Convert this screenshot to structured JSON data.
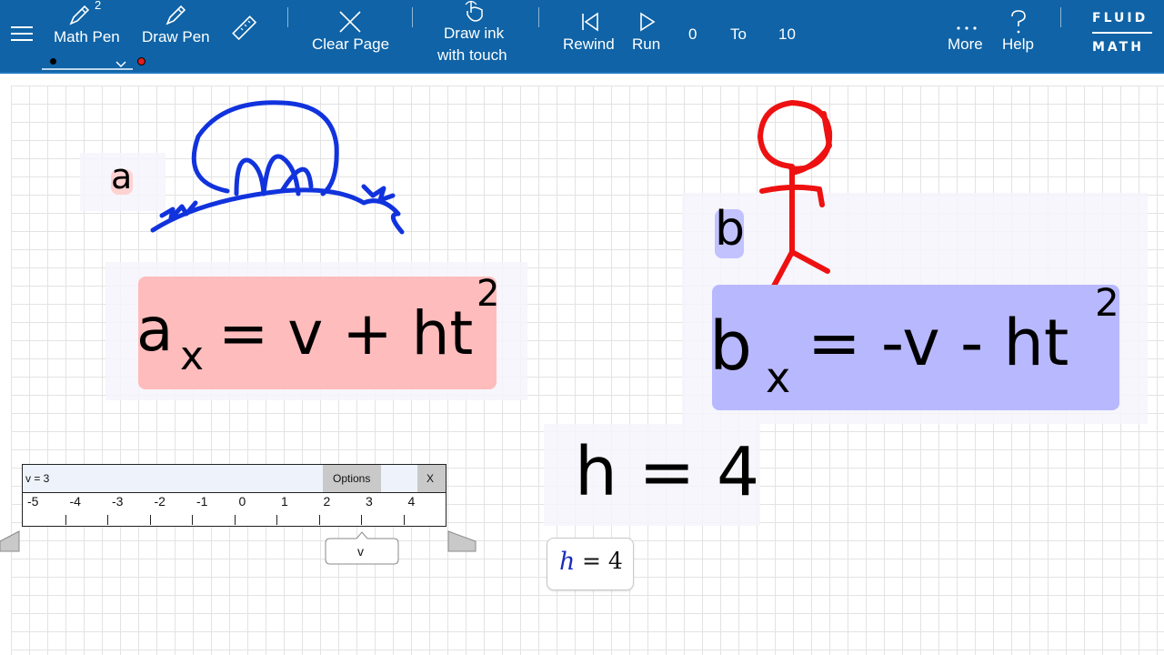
{
  "toolbar": {
    "math_pen_label": "Math Pen",
    "math_pen_badge": "2",
    "draw_pen_label": "Draw Pen",
    "clear_page_label": "Clear Page",
    "draw_ink_label_line1": "Draw ink",
    "draw_ink_label_line2": "with touch",
    "rewind_label": "Rewind",
    "run_label": "Run",
    "range_start": "0",
    "range_to": "To",
    "range_end": "10",
    "more_label": "More",
    "help_label": "Help",
    "brand_line1": "FLUID",
    "brand_line2": "MATH",
    "pen_color_black": "#000000",
    "pen_color_red": "#e11d1d"
  },
  "canvas": {
    "label_a": "a",
    "label_b": "b",
    "eq_a_lhs": "a",
    "eq_a_sub": "x",
    "eq_a_rhs": "= v + ht",
    "eq_a_sup": "2",
    "eq_b_lhs": "b",
    "eq_b_sub": "x",
    "eq_b_rhs": "= -v - ht",
    "eq_b_sup": "2",
    "h_ink": "h = 4",
    "h_var": "h",
    "h_eq": "= 4",
    "colors": {
      "blob_blue": "#1133dd",
      "stick_red": "#ee1111",
      "box_pink": "#ffbcbc",
      "box_lavender": "#b8b8ff"
    }
  },
  "slider": {
    "value_text": "v = 3",
    "options_label": "Options",
    "close_label": "X",
    "ticks": [
      "-5",
      "-4",
      "-3",
      "-2",
      "-1",
      "0",
      "1",
      "2",
      "3",
      "4"
    ],
    "pointer_label": "v"
  }
}
